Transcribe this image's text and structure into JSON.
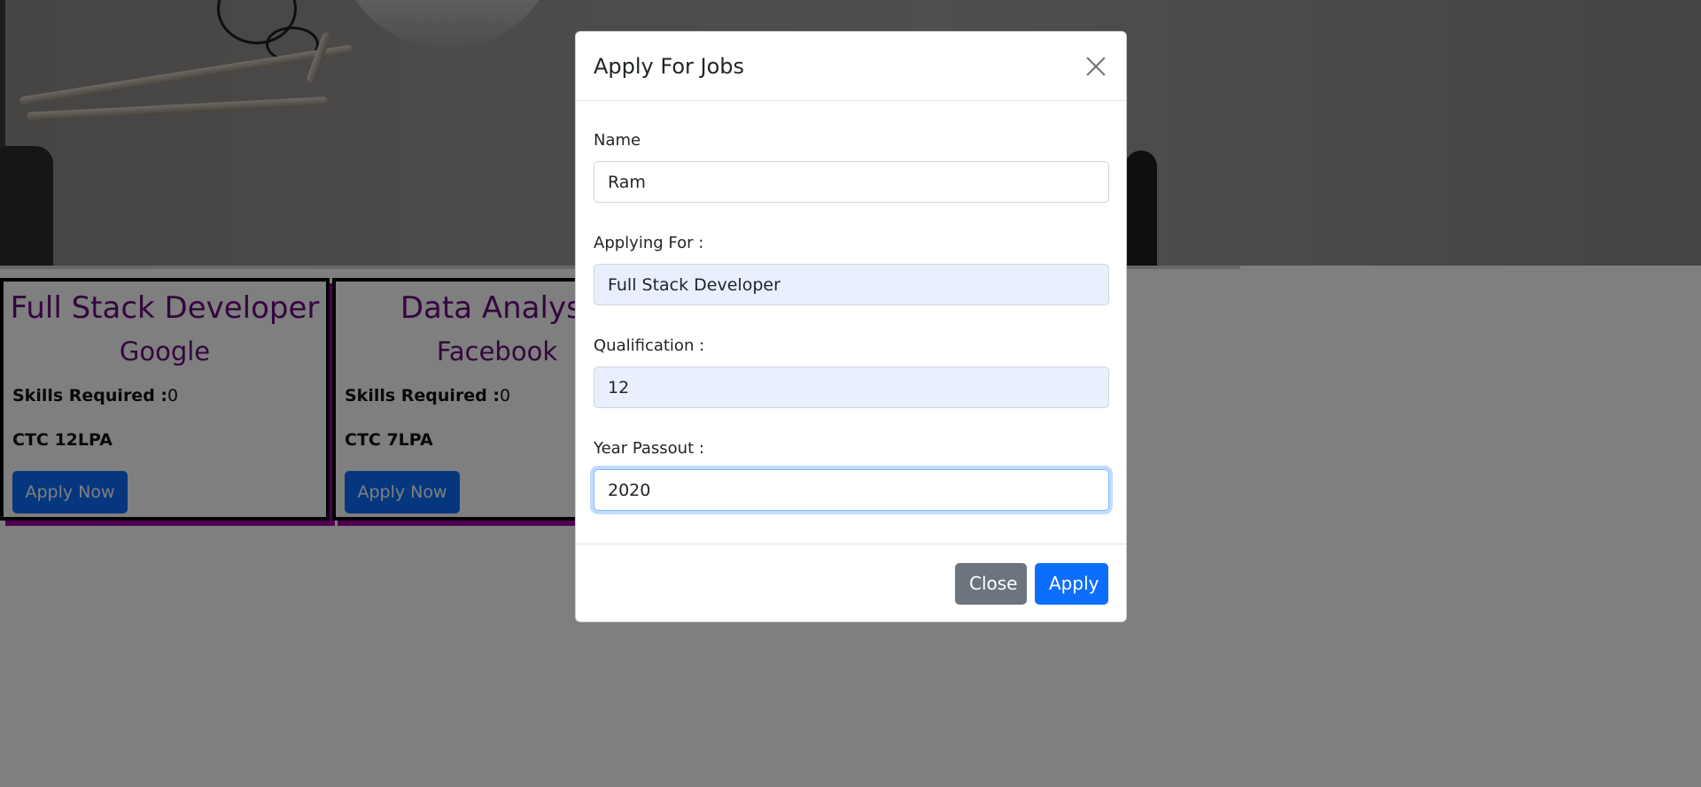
{
  "jobs": [
    {
      "title": "Full Stack Developer",
      "company": "Google",
      "skills_label": "Skills Required :",
      "skills_value": "0",
      "ctc": "CTC 12LPA",
      "apply_label": "Apply Now"
    },
    {
      "title": "Data Analyst",
      "company": "Facebook",
      "skills_label": "Skills Required :",
      "skills_value": "0",
      "ctc": "CTC 7LPA",
      "apply_label": "Apply Now"
    }
  ],
  "modal": {
    "title": "Apply For Jobs",
    "fields": {
      "name": {
        "label": "Name",
        "value": "Ram"
      },
      "applying_for": {
        "label": "Applying For :",
        "value": "Full Stack Developer"
      },
      "qualification": {
        "label": "Qualification :",
        "value": "12"
      },
      "year_passout": {
        "label": "Year Passout :",
        "value": "2020"
      }
    },
    "close_label": "Close",
    "apply_label": "Apply"
  },
  "colors": {
    "accent": "#0d6efd",
    "secondary": "#6c757d",
    "job_title": "#6a0a7e",
    "card_shadow": "#a000a0",
    "autofill_bg": "#e8f0fe"
  },
  "icons": [
    "close-icon"
  ]
}
